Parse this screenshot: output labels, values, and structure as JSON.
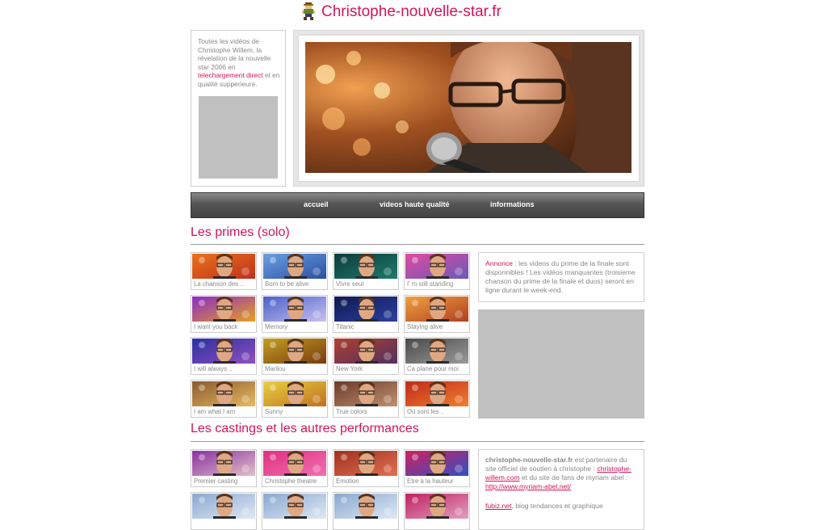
{
  "header": {
    "title": "Christophe-nouvelle-star.fr",
    "logo_icon": "pixel-character-icon"
  },
  "intro": {
    "text_before": "Toutes les vidéos de Christophe Willem, la révelation de la nouvelle star 2006 en",
    "link": "telechargement direct",
    "text_after": "et en qualité supperieure."
  },
  "nav": {
    "items": [
      "accueil",
      "videos haute qualité",
      "informations"
    ]
  },
  "sections": {
    "primes_title": "Les primes (solo)",
    "castings_title": "Les castings et les autres performances"
  },
  "primes": [
    {
      "label": "La chanson des ..",
      "colors": [
        "#e8721c",
        "#c0301c"
      ]
    },
    {
      "label": "Born to be alive",
      "colors": [
        "#6aa0e0",
        "#2c4fa0"
      ]
    },
    {
      "label": "Vivre seul",
      "colors": [
        "#0c3b3c",
        "#1e7a6a"
      ]
    },
    {
      "label": "I' m still standing",
      "colors": [
        "#e04aa0",
        "#6a5ab8"
      ]
    },
    {
      "label": "I want you back",
      "colors": [
        "#8a2ac8",
        "#e8a020"
      ]
    },
    {
      "label": "Memory",
      "colors": [
        "#4a60c8",
        "#c8c0f0"
      ]
    },
    {
      "label": "Titanic",
      "colors": [
        "#101a50",
        "#2a40a0"
      ]
    },
    {
      "label": "Staying alive",
      "colors": [
        "#f0a040",
        "#b04020"
      ]
    },
    {
      "label": "I will always ..",
      "colors": [
        "#2a30a0",
        "#9050c0"
      ]
    },
    {
      "label": "Marilou",
      "colors": [
        "#c0a020",
        "#7a3a10"
      ]
    },
    {
      "label": "New York",
      "colors": [
        "#b04030",
        "#503060"
      ]
    },
    {
      "label": "Ca plane pour moi",
      "colors": [
        "#4a4a4a",
        "#9a9a9a"
      ]
    },
    {
      "label": "I am what I am",
      "colors": [
        "#8a5a30",
        "#e8b860"
      ]
    },
    {
      "label": "Sunny",
      "colors": [
        "#e8d040",
        "#c07020"
      ]
    },
    {
      "label": "True colors",
      "colors": [
        "#6a3a2a",
        "#c09070"
      ]
    },
    {
      "label": "Où sont les ..",
      "colors": [
        "#c02818",
        "#f08030"
      ]
    }
  ],
  "castings": [
    {
      "label": "Premier casting",
      "colors": [
        "#8a30a0",
        "#e0c0c8"
      ]
    },
    {
      "label": "Christophe theatre",
      "colors": [
        "#e03080",
        "#f070b0"
      ]
    },
    {
      "label": "Emotion",
      "colors": [
        "#a03020",
        "#e07050"
      ]
    },
    {
      "label": "Etre à la hauteur",
      "colors": [
        "#d02060",
        "#3050c0"
      ]
    },
    {
      "label": "",
      "colors": [
        "#8aa8d0",
        "#dfe8f4"
      ]
    },
    {
      "label": "",
      "colors": [
        "#8aa8d0",
        "#dfe8f4"
      ]
    },
    {
      "label": "",
      "colors": [
        "#8aa8d0",
        "#dfe8f4"
      ]
    },
    {
      "label": "",
      "colors": [
        "#c02060",
        "#e0a0c0"
      ]
    }
  ],
  "annonce": {
    "title": "Annonce",
    "text": ": les videos du prime de la finale sont disponnibles ! Les vidéos manquantes (troisieme chanson du prime de la finale et duos) seront en ligne durant le week-end."
  },
  "partners": {
    "site": "christophe-nouvelle-star.fr",
    "text1": "est partenaire du site officiel de soutien à christophe :",
    "link1": "christophe-willem.com",
    "text2": "et du site de fans de myriam abel :",
    "link2": "http://www.myriam-abel.net/",
    "link3": "fubiz.net",
    "text3": ", blog tendances et graphique"
  },
  "colors": {
    "accent": "#d4145a",
    "ad_placeholder": "#c0c0c0"
  }
}
